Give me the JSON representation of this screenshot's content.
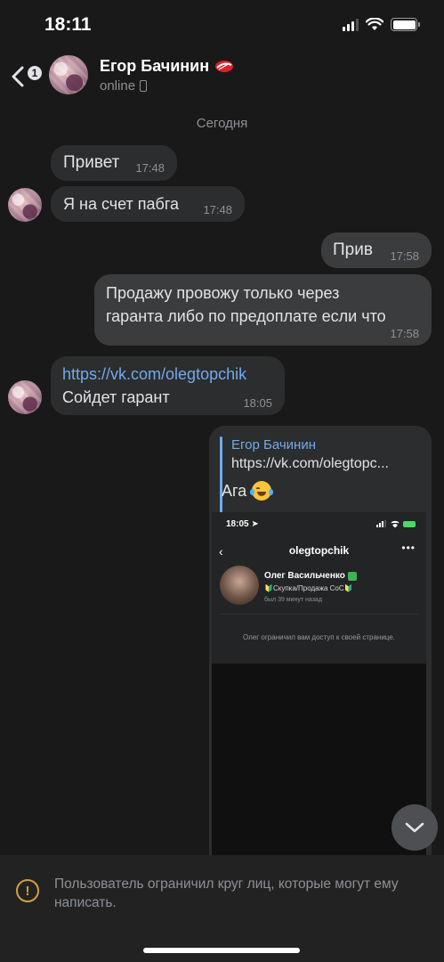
{
  "status_bar": {
    "time": "18:11"
  },
  "header": {
    "back_badge": "1",
    "name": "Егор Бачинин",
    "status": "online"
  },
  "chat": {
    "date_separator": "Сегодня",
    "messages": [
      {
        "text": "Привет",
        "time": "17:48",
        "direction": "in"
      },
      {
        "text": "Я на счет пабга",
        "time": "17:48",
        "direction": "in"
      },
      {
        "text": "Прив",
        "time": "17:58",
        "direction": "out"
      },
      {
        "line1": "Продажу провожу только через",
        "line2": "гаранта либо по предоплате если что",
        "time": "17:58",
        "direction": "out"
      },
      {
        "link": "https://vk.com/olegtopchik",
        "text": "Сойдет гарант",
        "time": "18:05",
        "direction": "in"
      }
    ],
    "reply_message": {
      "quoted_author": "Егор Бачинин",
      "quoted_text": "https://vk.com/olegtopc...",
      "text": "Ага",
      "emoji_icon": "laughing-tears-emoji"
    },
    "attached_screenshot": {
      "time": "18:05",
      "username": "olegtopchik",
      "profile_name": "Олег Васильченко",
      "bio": "🔰Скупка/Продажа CoC🔰",
      "last_seen": "был 39 минут назад",
      "restriction_note": "Олег ограничил вам доступ к своей странице."
    }
  },
  "bottom_notice": {
    "text": "Пользователь ограничил круг лиц, которые могут ему написать."
  },
  "colors": {
    "background": "#191919",
    "bubble_in": "#2c2d2e",
    "bubble_out": "#3b3c3e",
    "link": "#71aaeb",
    "warning": "#d1a13c"
  }
}
